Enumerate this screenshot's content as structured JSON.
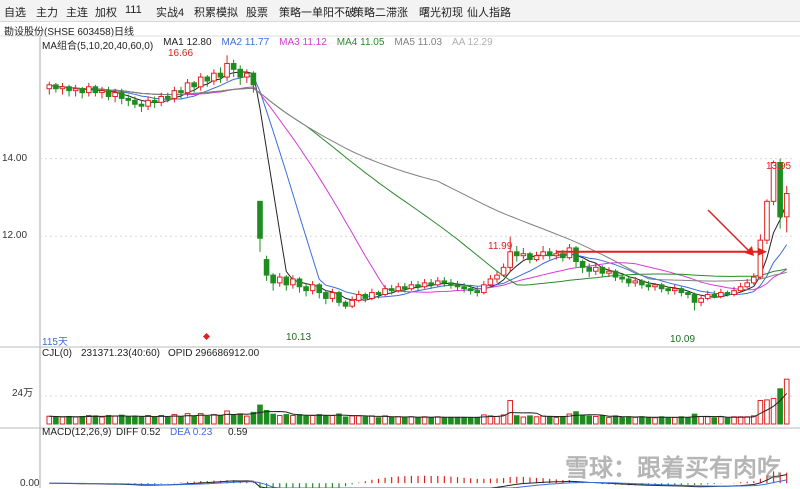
{
  "menu": [
    "自选",
    "主力",
    "主连",
    "加权",
    "111",
    "实战4",
    "积累模拟",
    "股票",
    "策略一单阳不破",
    "策略二滞涨",
    "曙光初现",
    "仙人指路"
  ],
  "stock_title": "勘设股份(SHSE 603458)日线",
  "ma_legend": [
    {
      "label": "MA组合(5,10,20,40,60,0)",
      "color": "#222222"
    },
    {
      "label": "MA1 12.80",
      "color": "#222222"
    },
    {
      "label": "MA2 11.77",
      "color": "#3a6fd8"
    },
    {
      "label": "MA3 11.12",
      "color": "#d63ad6"
    },
    {
      "label": "MA4 11.05",
      "color": "#2a8a2a"
    },
    {
      "label": "MA5 11.03",
      "color": "#808080"
    },
    {
      "label": "AA 12.29",
      "color": "#b0b0b0"
    }
  ],
  "price_axis": [
    "14.00",
    "12.00"
  ],
  "annotations": {
    "high_left": "16.66",
    "low_left": "10.13",
    "mid_high": "11.99",
    "low_right": "10.09",
    "high_right": "13.95",
    "days": "115天"
  },
  "vol_legend": {
    "name": "CJL(0)",
    "value": "231371.23(40:60)",
    "opid": "OPID 296686912.00"
  },
  "vol_axis": "24万",
  "macd_legend": {
    "name": "MACD(12,26,9)",
    "diff": "DIFF 0.52",
    "dea": "DEA 0.23",
    "macd": "0.59"
  },
  "macd_axis": "0.00",
  "watermark": "雪球：跟着买有肉吃",
  "colors": {
    "up": "#e02020",
    "down": "#1e8c1e",
    "arrow": "#e02020"
  },
  "chart_data": {
    "type": "candlestick",
    "title": "勘设股份(SHSE 603458)日线",
    "ylim": [
      9.2,
      16.9
    ],
    "candles": [
      [
        15.8,
        15.9,
        15.65,
        15.98
      ],
      [
        15.9,
        15.8,
        15.7,
        15.95
      ],
      [
        15.8,
        15.85,
        15.65,
        15.95
      ],
      [
        15.85,
        15.75,
        15.6,
        15.9
      ],
      [
        15.75,
        15.8,
        15.6,
        15.9
      ],
      [
        15.8,
        15.7,
        15.55,
        15.85
      ],
      [
        15.7,
        15.85,
        15.6,
        15.95
      ],
      [
        15.85,
        15.7,
        15.6,
        15.9
      ],
      [
        15.7,
        15.75,
        15.55,
        15.85
      ],
      [
        15.75,
        15.6,
        15.5,
        15.85
      ],
      [
        15.6,
        15.7,
        15.45,
        15.8
      ],
      [
        15.7,
        15.55,
        15.4,
        15.8
      ],
      [
        15.55,
        15.5,
        15.35,
        15.65
      ],
      [
        15.5,
        15.4,
        15.3,
        15.6
      ],
      [
        15.4,
        15.35,
        15.2,
        15.5
      ],
      [
        15.35,
        15.5,
        15.25,
        15.6
      ],
      [
        15.5,
        15.45,
        15.3,
        15.6
      ],
      [
        15.45,
        15.6,
        15.35,
        15.7
      ],
      [
        15.6,
        15.55,
        15.45,
        15.7
      ],
      [
        15.55,
        15.75,
        15.45,
        15.85
      ],
      [
        15.75,
        15.7,
        15.55,
        15.85
      ],
      [
        15.7,
        15.95,
        15.6,
        16.05
      ],
      [
        15.95,
        15.85,
        15.7,
        16.0
      ],
      [
        15.85,
        16.1,
        15.75,
        16.2
      ],
      [
        16.1,
        16.0,
        15.85,
        16.15
      ],
      [
        16.0,
        16.2,
        15.9,
        16.3
      ],
      [
        16.2,
        16.1,
        15.95,
        16.35
      ],
      [
        16.1,
        16.45,
        16.0,
        16.66
      ],
      [
        16.45,
        16.3,
        16.1,
        16.55
      ],
      [
        16.3,
        16.1,
        15.9,
        16.4
      ],
      [
        16.1,
        16.2,
        15.95,
        16.3
      ],
      [
        16.2,
        15.9,
        15.7,
        16.25
      ],
      [
        12.9,
        11.95,
        11.6,
        12.1
      ],
      [
        11.4,
        11.0,
        10.85,
        11.5
      ],
      [
        11.0,
        10.8,
        10.6,
        11.05
      ],
      [
        10.8,
        10.95,
        10.7,
        11.05
      ],
      [
        10.95,
        10.75,
        10.6,
        11.0
      ],
      [
        10.75,
        10.9,
        10.65,
        11.0
      ],
      [
        10.9,
        10.7,
        10.55,
        10.95
      ],
      [
        10.7,
        10.6,
        10.45,
        10.8
      ],
      [
        10.6,
        10.75,
        10.5,
        10.85
      ],
      [
        10.75,
        10.55,
        10.4,
        10.8
      ],
      [
        10.55,
        10.4,
        10.25,
        10.6
      ],
      [
        10.4,
        10.55,
        10.3,
        10.65
      ],
      [
        10.55,
        10.3,
        10.2,
        10.6
      ],
      [
        10.3,
        10.2,
        10.13,
        10.35
      ],
      [
        10.2,
        10.35,
        10.15,
        10.45
      ],
      [
        10.35,
        10.5,
        10.3,
        10.6
      ],
      [
        10.5,
        10.4,
        10.3,
        10.55
      ],
      [
        10.4,
        10.55,
        10.35,
        10.65
      ],
      [
        10.55,
        10.5,
        10.4,
        10.6
      ],
      [
        10.5,
        10.65,
        10.45,
        10.75
      ],
      [
        10.65,
        10.6,
        10.5,
        10.75
      ],
      [
        10.6,
        10.7,
        10.55,
        10.8
      ],
      [
        10.7,
        10.65,
        10.55,
        10.8
      ],
      [
        10.65,
        10.75,
        10.6,
        10.85
      ],
      [
        10.75,
        10.7,
        10.6,
        10.85
      ],
      [
        10.7,
        10.8,
        10.65,
        10.9
      ],
      [
        10.8,
        10.75,
        10.65,
        10.9
      ],
      [
        10.75,
        10.85,
        10.7,
        10.95
      ],
      [
        10.85,
        10.8,
        10.7,
        10.95
      ],
      [
        10.8,
        10.75,
        10.65,
        10.9
      ],
      [
        10.75,
        10.7,
        10.6,
        10.85
      ],
      [
        10.7,
        10.65,
        10.55,
        10.8
      ],
      [
        10.65,
        10.6,
        10.5,
        10.75
      ],
      [
        10.6,
        10.55,
        10.45,
        10.7
      ],
      [
        10.55,
        10.75,
        10.5,
        10.85
      ],
      [
        10.75,
        10.9,
        10.7,
        11.0
      ],
      [
        10.9,
        11.0,
        10.8,
        11.1
      ],
      [
        11.0,
        11.2,
        10.95,
        11.3
      ],
      [
        11.2,
        11.6,
        11.1,
        11.99
      ],
      [
        11.6,
        11.5,
        11.35,
        11.75
      ],
      [
        11.5,
        11.55,
        11.4,
        11.7
      ],
      [
        11.55,
        11.4,
        11.3,
        11.6
      ],
      [
        11.4,
        11.5,
        11.35,
        11.6
      ],
      [
        11.5,
        11.6,
        11.4,
        11.75
      ],
      [
        11.6,
        11.5,
        11.4,
        11.7
      ],
      [
        11.5,
        11.55,
        11.4,
        11.65
      ],
      [
        11.55,
        11.45,
        11.35,
        11.65
      ],
      [
        11.45,
        11.7,
        11.4,
        11.8
      ],
      [
        11.7,
        11.35,
        11.2,
        11.75
      ],
      [
        11.35,
        11.2,
        11.05,
        11.4
      ],
      [
        11.2,
        11.1,
        10.95,
        11.3
      ],
      [
        11.1,
        11.2,
        11.0,
        11.3
      ],
      [
        11.2,
        11.05,
        10.95,
        11.25
      ],
      [
        11.05,
        11.1,
        10.95,
        11.2
      ],
      [
        11.1,
        10.95,
        10.85,
        11.15
      ],
      [
        10.95,
        10.9,
        10.8,
        11.05
      ],
      [
        10.9,
        10.8,
        10.7,
        10.95
      ],
      [
        10.8,
        10.85,
        10.7,
        10.95
      ],
      [
        10.85,
        10.75,
        10.65,
        10.9
      ],
      [
        10.75,
        10.7,
        10.6,
        10.85
      ],
      [
        10.7,
        10.75,
        10.6,
        10.8
      ],
      [
        10.75,
        10.65,
        10.55,
        10.8
      ],
      [
        10.65,
        10.6,
        10.5,
        10.7
      ],
      [
        10.6,
        10.65,
        10.5,
        10.75
      ],
      [
        10.65,
        10.55,
        10.45,
        10.7
      ],
      [
        10.55,
        10.5,
        10.4,
        10.6
      ],
      [
        10.5,
        10.3,
        10.09,
        10.55
      ],
      [
        10.3,
        10.4,
        10.2,
        10.5
      ],
      [
        10.4,
        10.5,
        10.35,
        10.6
      ],
      [
        10.5,
        10.45,
        10.4,
        10.6
      ],
      [
        10.45,
        10.55,
        10.4,
        10.65
      ],
      [
        10.55,
        10.5,
        10.45,
        10.6
      ],
      [
        10.5,
        10.6,
        10.45,
        10.7
      ],
      [
        10.6,
        10.7,
        10.55,
        10.8
      ],
      [
        10.7,
        10.8,
        10.65,
        10.9
      ],
      [
        10.8,
        10.95,
        10.75,
        11.05
      ],
      [
        10.95,
        11.9,
        10.9,
        12.05
      ],
      [
        11.9,
        12.9,
        11.8,
        12.95
      ],
      [
        12.9,
        13.9,
        12.8,
        13.95
      ],
      [
        13.9,
        12.5,
        12.2,
        14.0
      ],
      [
        12.5,
        13.1,
        12.1,
        13.3
      ]
    ],
    "volume_range": [
      0,
      300000
    ],
    "macd_range": [
      -0.1,
      0.9
    ]
  }
}
